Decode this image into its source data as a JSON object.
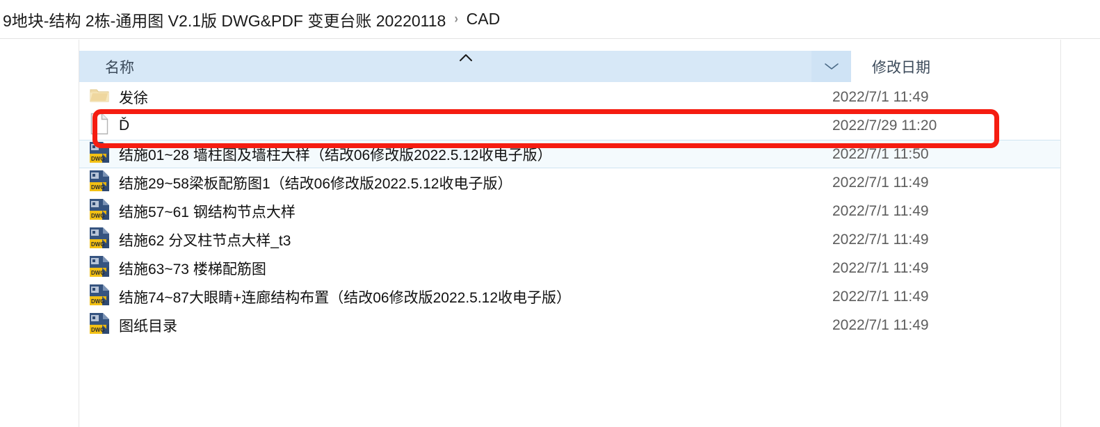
{
  "window": {
    "title": "CAD"
  },
  "breadcrumb": {
    "separator": "›",
    "items": [
      {
        "label": "9地块-结构 2栋-通用图 V2.1版 DWG&PDF 变更台账 20220118"
      },
      {
        "label": "CAD"
      }
    ]
  },
  "columns": {
    "name": {
      "label": "名称",
      "sort": "ascending",
      "sort_icon": "caret-up-icon"
    },
    "splitter": {
      "icon": "chevron-down-icon"
    },
    "date": {
      "label": "修改日期"
    }
  },
  "files": [
    {
      "name": "发徐",
      "date": "2022/7/1 11:49",
      "icon": "folder-icon",
      "type": "folder",
      "hovered": false
    },
    {
      "name": "Ď",
      "date": "2022/7/29 11:20",
      "icon": "blank-file-icon",
      "type": "file",
      "hovered": false
    },
    {
      "name": "结施01~28 墙柱图及墙柱大样（结改06修改版2022.5.12收电子版）",
      "date": "2022/7/1 11:50",
      "icon": "dwg-file-icon",
      "type": "dwg",
      "hovered": true
    },
    {
      "name": "结施29~58梁板配筋图1（结改06修改版2022.5.12收电子版）",
      "date": "2022/7/1 11:49",
      "icon": "dwg-file-icon",
      "type": "dwg",
      "hovered": false
    },
    {
      "name": "结施57~61 钢结构节点大样",
      "date": "2022/7/1 11:49",
      "icon": "dwg-file-icon",
      "type": "dwg",
      "hovered": false
    },
    {
      "name": "结施62 分叉柱节点大样_t3",
      "date": "2022/7/1 11:49",
      "icon": "dwg-file-icon",
      "type": "dwg",
      "hovered": false
    },
    {
      "name": "结施63~73 楼梯配筋图",
      "date": "2022/7/1 11:49",
      "icon": "dwg-file-icon",
      "type": "dwg",
      "hovered": false
    },
    {
      "name": "结施74~87大眼睛+连廊结构布置（结改06修改版2022.5.12收电子版）",
      "date": "2022/7/1 11:49",
      "icon": "dwg-file-icon",
      "type": "dwg",
      "hovered": false
    },
    {
      "name": "图纸目录",
      "date": "2022/7/1 11:49",
      "icon": "dwg-file-icon",
      "type": "dwg",
      "hovered": false
    }
  ],
  "annotation": {
    "highlight_box": {
      "color": "#f51d11",
      "shape": "rounded-rectangle",
      "covers_rows": [
        1,
        2
      ]
    }
  },
  "colors": {
    "header_name_bg": "#d7e8f7",
    "header_split_bg": "#cfe3f5",
    "hover_row_bg": "#f4fafd",
    "hover_row_border": "#cfe4f2",
    "annotation_red": "#f51d11",
    "date_text": "#5d5d5d",
    "name_text": "#111111"
  }
}
